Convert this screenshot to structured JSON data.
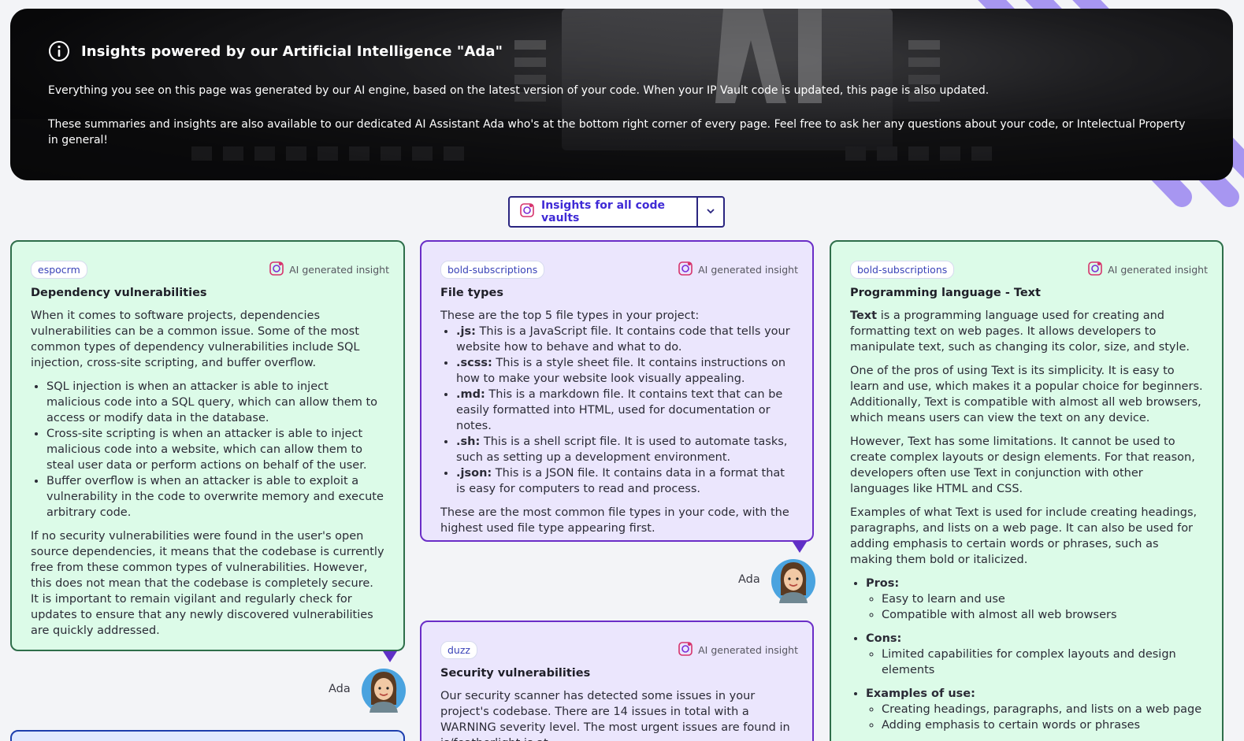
{
  "banner": {
    "title": "Insights powered by our Artificial Intelligence \"Ada\"",
    "paragraph1": "Everything you see on this page was generated by our AI engine, based on the latest version of your code. When your IP Vault code is updated, this page is also updated.",
    "paragraph2": "These summaries and insights are also available to our dedicated AI Assistant Ada who's at the bottom right corner of every page. Feel free to ask her any questions about your code, or Intelectual Property in general!",
    "icon": "info-icon"
  },
  "selector": {
    "label": "Insights for all code vaults",
    "icon": "ai-brain-icon"
  },
  "ai_label": "AI generated insight",
  "ada_name": "Ada",
  "colors": {
    "green_bg": "#dcfbe8",
    "green_border": "#2e6e4a",
    "purple_bg": "#ebe6fd",
    "purple_border": "#6a2dc7",
    "accent": "#3f2ad6"
  },
  "cards": {
    "dependency": {
      "tag": "espocrm",
      "title": "Dependency vulnerabilities",
      "intro": "When it comes to software projects, dependencies vulnerabilities can be a common issue. Some of the most common types of dependency vulnerabilities include SQL injection, cross-site scripting, and buffer overflow.",
      "items": [
        "SQL injection is when an attacker is able to inject malicious code into a SQL query, which can allow them to access or modify data in the database.",
        "Cross-site scripting is when an attacker is able to inject malicious code into a website, which can allow them to steal user data or perform actions on behalf of the user.",
        "Buffer overflow is when an attacker is able to exploit a vulnerability in the code to overwrite memory and execute arbitrary code."
      ],
      "outro": "If no security vulnerabilities were found in the user's open source dependencies, it means that the codebase is currently free from these common types of vulnerabilities. However, this does not mean that the codebase is completely secure. It is important to remain vigilant and regularly check for updates to ensure that any newly discovered vulnerabilities are quickly addressed."
    },
    "filetypes": {
      "tag": "bold-subscriptions",
      "title": "File types",
      "intro": "These are the top 5 file types in your project:",
      "items": [
        {
          "ext": ".js:",
          "text": " This is a JavaScript file. It contains code that tells your website how to behave and what to do."
        },
        {
          "ext": ".scss:",
          "text": " This is a style sheet file. It contains instructions on how to make your website look visually appealing."
        },
        {
          "ext": ".md:",
          "text": " This is a markdown file. It contains text that can be easily formatted into HTML, used for documentation or notes."
        },
        {
          "ext": ".sh:",
          "text": " This is a shell script file. It is used to automate tasks, such as setting up a development environment."
        },
        {
          "ext": ".json:",
          "text": " This is a JSON file. It contains data in a format that is easy for computers to read and process."
        }
      ],
      "outro": "These are the most common file types in your code, with the highest used file type appearing first."
    },
    "security": {
      "tag": "duzz",
      "title": "Security vulnerabilities",
      "intro": "Our security scanner has detected some issues in your project's codebase. There are 14 issues in total with a WARNING severity level. The most urgent issues are found in js/featherlight.js at"
    },
    "language": {
      "tag": "bold-subscriptions",
      "title": "Programming language - Text",
      "p1_bold": "Text",
      "p1": " is a programming language used for creating and formatting text on web pages. It allows developers to manipulate text, such as changing its color, size, and style.",
      "p2": "One of the pros of using Text is its simplicity. It is easy to learn and use, which makes it a popular choice for beginners. Additionally, Text is compatible with almost all web browsers, which means users can view the text on any device.",
      "p3": "However, Text has some limitations. It cannot be used to create complex layouts or design elements. For that reason, developers often use Text in conjunction with other languages like HTML and CSS.",
      "p4": "Examples of what Text is used for include creating headings, paragraphs, and lists on a web page. It can also be used for adding emphasis to certain words or phrases, such as making them bold or italicized.",
      "pros_label": "Pros:",
      "pros": [
        "Easy to learn and use",
        "Compatible with almost all web browsers"
      ],
      "cons_label": "Cons:",
      "cons": [
        "Limited capabilities for complex layouts and design elements"
      ],
      "examples_label": "Examples of use:",
      "examples": [
        "Creating headings, paragraphs, and lists on a web page",
        "Adding emphasis to certain words or phrases"
      ]
    }
  }
}
